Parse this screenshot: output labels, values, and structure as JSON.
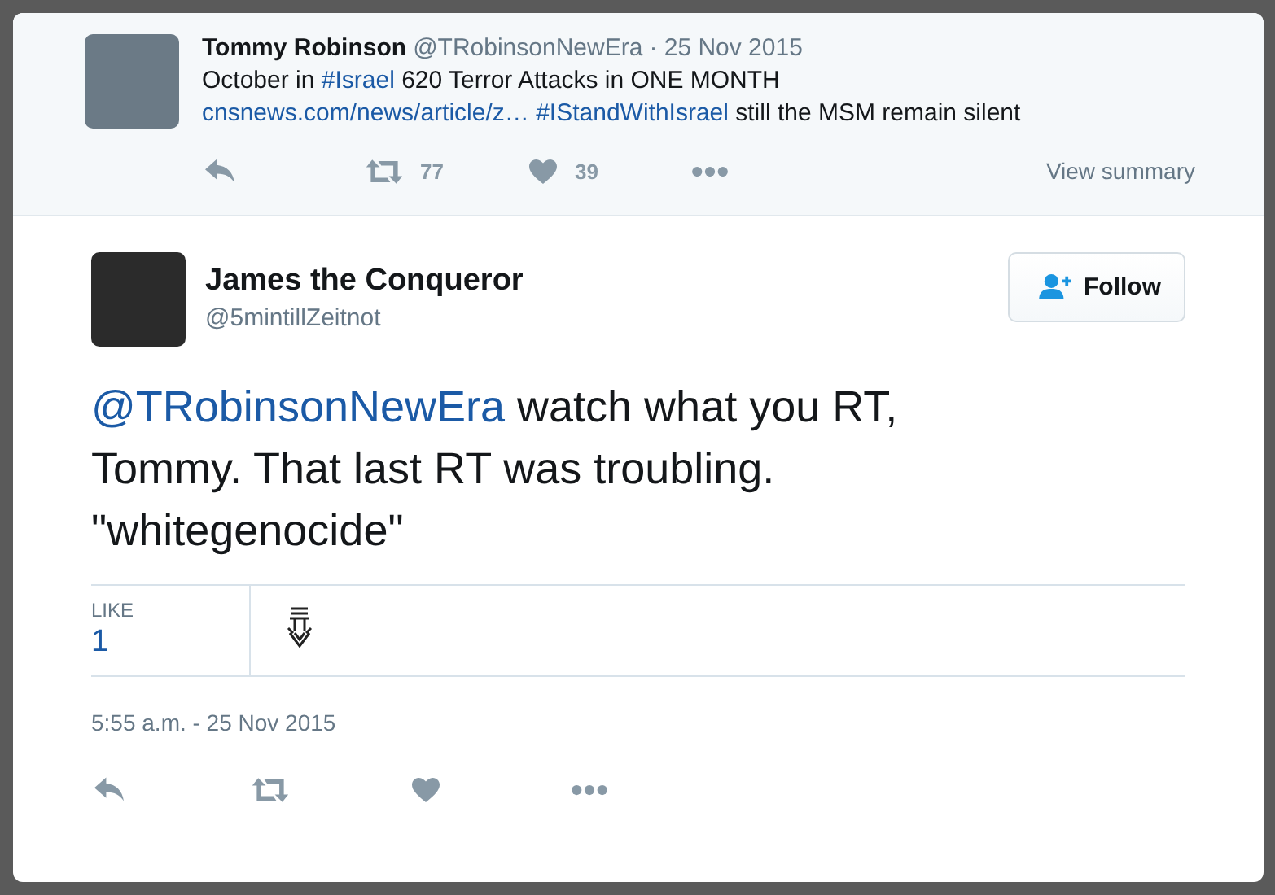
{
  "quoted_tweet": {
    "name": "Tommy Robinson",
    "handle": "@TRobinsonNewEra",
    "date": "· 25 Nov 2015",
    "text": [
      {
        "kind": "plain",
        "text": "October in "
      },
      {
        "kind": "link",
        "text": "#Israel"
      },
      {
        "kind": "plain",
        "text": " 620 Terror Attacks in ONE MONTH "
      },
      {
        "kind": "link",
        "text": "cnsnews.com/news/article/z… "
      },
      {
        "kind": "link",
        "text": "#IStandWithIsrael"
      },
      {
        "kind": "plain",
        "text": " still the MSM remain silent"
      }
    ],
    "actions": [
      {
        "kind": "reply"
      },
      {
        "kind": "retweet",
        "count": "77"
      },
      {
        "kind": "like",
        "count": "39"
      },
      {
        "kind": "more"
      }
    ],
    "view_summary": "View summary"
  },
  "tweet": {
    "name": "James the Conqueror",
    "handle": "@5mintillZeitnot",
    "follow_button": "Follow",
    "text": [
      {
        "kind": "link",
        "text": "@TRobinsonNewEra"
      },
      {
        "kind": "plain",
        "text": " watch what you RT, Tommy. That last RT was troubling. \"whitegenocide\""
      }
    ],
    "stats": {
      "label": "LIKE",
      "count": "1"
    },
    "timestamp": "5:55 a.m. - 25 Nov 2015",
    "actions": [
      {
        "kind": "reply"
      },
      {
        "kind": "retweet"
      },
      {
        "kind": "like"
      },
      {
        "kind": "more"
      }
    ]
  }
}
